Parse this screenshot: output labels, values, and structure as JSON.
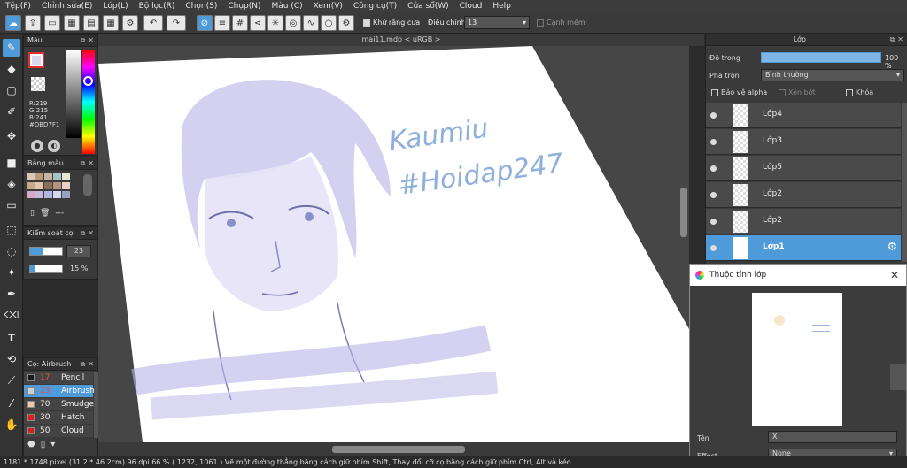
{
  "menu": [
    "Tệp(F)",
    "Chỉnh sửa(E)",
    "Lớp(L)",
    "Bộ lọc(R)",
    "Chọn(S)",
    "Chụp(N)",
    "Màu (C)",
    "Xem(V)",
    "Công cụ(T)",
    "Cửa sổ(W)",
    "Cloud",
    "Help"
  ],
  "toolbar": {
    "antialias_label": "Khử răng cưa",
    "correction_label": "Điều chỉnh",
    "correction_value": "13",
    "edge_label": "Cạnh mềm"
  },
  "document": {
    "tab_title": "mai11.mdp < uRGB >"
  },
  "color_panel": {
    "title": "Màu",
    "rgb": [
      "R:219",
      "G:215",
      "B:241"
    ],
    "hex": "#DBD7F1",
    "current_color": "#dbd7f1"
  },
  "palette_panel": {
    "title": "Bảng màu",
    "more": "---"
  },
  "brush_control_panel": {
    "title": "Kiểm soát cọ",
    "size": "23",
    "opacity": "15 %"
  },
  "brush_panel": {
    "title": "Cọ: Airbrush",
    "items": [
      {
        "size": "17",
        "name": "Pencil",
        "color": "#1a1a1a"
      },
      {
        "size": "23",
        "name": "Airbrush",
        "color": "#d0d0d0"
      },
      {
        "size": "70",
        "name": "Smudge",
        "color": "#f2c9a5"
      },
      {
        "size": "30",
        "name": "Hatch",
        "color": "#e02020"
      },
      {
        "size": "50",
        "name": "Cloud",
        "color": "#d02020"
      }
    ]
  },
  "layer_panel": {
    "title": "Lớp",
    "opacity_label": "Độ trong",
    "opacity_value": "100 %",
    "blend_label": "Pha trộn",
    "blend_value": "Bình thường",
    "protect_alpha": "Bảo vệ alpha",
    "clipping": "Xén bớt",
    "lock": "Khóa",
    "layers": [
      "Lớp4",
      "Lớp3",
      "Lớp5",
      "Lớp2",
      "Lớp2",
      "Lớp1"
    ],
    "selected_index": 5
  },
  "properties_dialog": {
    "title": "Thuộc tính lớp",
    "name_label": "Tên",
    "name_value": "X",
    "effect_label": "Effect",
    "effect_value": "None"
  },
  "canvas": {
    "handwriting_1": "Kaumiu",
    "handwriting_2": "#Hoidap247"
  },
  "statusbar": {
    "size": "1181 * 1748 pixel",
    "cm": "(31.2 * 46.2cm)",
    "dpi": "96 dpi",
    "zoom": "66 %",
    "coords": "( 1232, 1061 )",
    "hint": "Vẽ một đường thẳng bằng cách giữ phím Shift, Thay đổi cỡ cọ bằng cách giữ phím Ctrl, Alt và kéo"
  },
  "colors": {
    "accent": "#4f9bd9",
    "panel": "#3a3a3a"
  }
}
